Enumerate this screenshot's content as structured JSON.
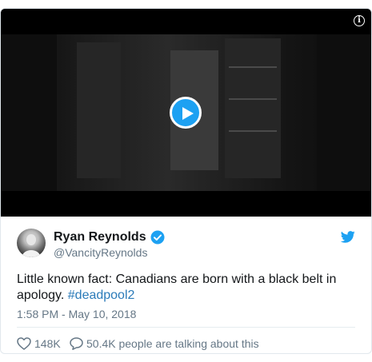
{
  "video": {
    "info_icon": "info-icon",
    "play_icon": "play-icon"
  },
  "tweet": {
    "display_name": "Ryan Reynolds",
    "handle": "@VancityReynolds",
    "text": "Little known fact: Canadians are born with a black belt in apology.",
    "hashtag": "#deadpool2",
    "timestamp": "1:58 PM - May 10, 2018",
    "likes": "148K",
    "replies_text": "50.4K people are talking about this"
  },
  "colors": {
    "brand": "#1da1f2",
    "link": "#2b7bb9",
    "muted": "#657786"
  }
}
